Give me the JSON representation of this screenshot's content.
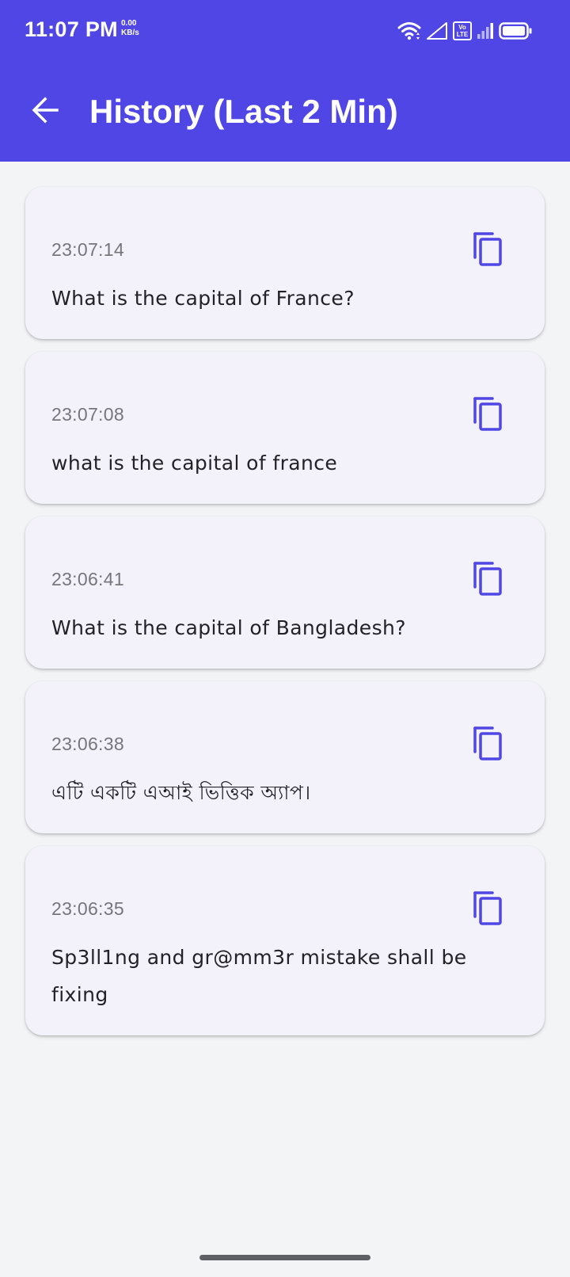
{
  "status_bar": {
    "time": "11:07 PM",
    "net_speed_value": "0.00",
    "net_speed_unit": "KB/s",
    "volte_line1": "Vo",
    "volte_line2": "LTE"
  },
  "header": {
    "title": "History (Last 2 Min)"
  },
  "colors": {
    "primary": "#4f46e5",
    "card_background": "#f3f2fb",
    "page_background": "#f3f4f6",
    "time_text": "#75757a",
    "body_text": "#222227"
  },
  "icons": {
    "back": "arrow-left-icon",
    "copy": "copy-icon"
  },
  "history": [
    {
      "time": "23:07:14",
      "text": "What is the capital of France?"
    },
    {
      "time": "23:07:08",
      "text": "what is the capital of france"
    },
    {
      "time": "23:06:41",
      "text": "What is the capital of Bangladesh?"
    },
    {
      "time": "23:06:38",
      "text": "এটি একটি এআই ভিত্তিক অ্যাপ।"
    },
    {
      "time": "23:06:35",
      "text": "Sp3ll1ng and gr@mm3r mistake shall be fixing"
    }
  ]
}
